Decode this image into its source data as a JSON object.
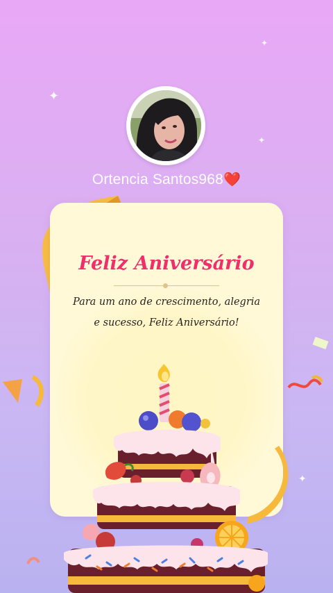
{
  "profile": {
    "username": "Ortencia Santos968",
    "heart_emoji": "❤️"
  },
  "card": {
    "title": "Feliz Aniversário",
    "message": "Para um ano de crescimento, alegria e sucesso, Feliz Aniversário!"
  },
  "colors": {
    "background_top": "#e9a8f6",
    "background_bottom": "#b9b2f0",
    "card_background": "#fff9d8",
    "title": "#ef2f6c",
    "ribbon": "#f6b93b"
  },
  "icons": {
    "sparkle": "four-point-star",
    "heart": "red-heart"
  }
}
